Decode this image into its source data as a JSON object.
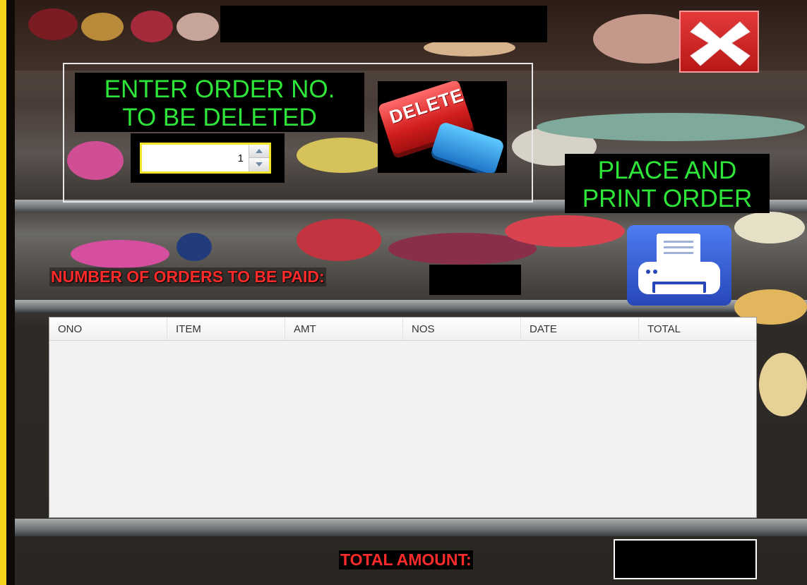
{
  "window": {
    "close_icon": "close-x-icon",
    "colors": {
      "accent_green": "#2ee53a",
      "warning_red": "#ff2a2a",
      "side_bar_yellow": "#f2d21a"
    }
  },
  "delete_section": {
    "prompt_line1": "ENTER ORDER NO.",
    "prompt_line2": "TO BE DELETED",
    "order_no_value": "1",
    "delete_button_text": "DELETE"
  },
  "print_section": {
    "label_line1": "PLACE AND",
    "label_line2": "PRINT ORDER",
    "print_icon": "printer-icon"
  },
  "orders_summary": {
    "label": "NUMBER OF ORDERS TO BE PAID:",
    "value": ""
  },
  "orders_table": {
    "columns": [
      "ONO",
      "ITEM",
      "AMT",
      "NOS",
      "DATE",
      "TOTAL"
    ],
    "rows": []
  },
  "total": {
    "label": "TOTAL AMOUNT:",
    "value": ""
  }
}
